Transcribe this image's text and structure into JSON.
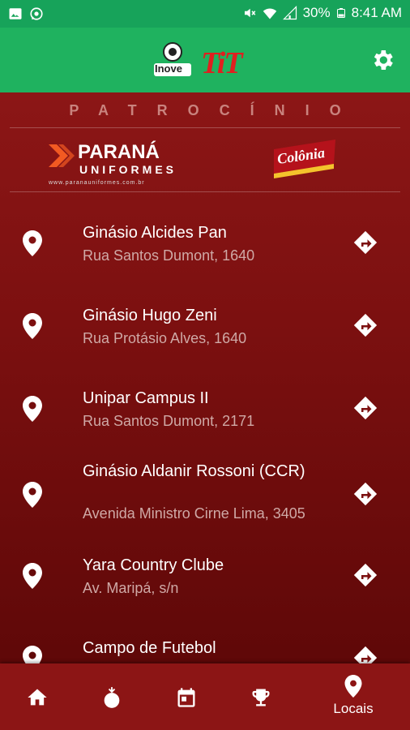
{
  "status_bar": {
    "battery": "30%",
    "time": "8:41 AM",
    "icons": [
      "image-icon",
      "whatsapp-icon",
      "mute-icon",
      "wifi-icon",
      "signal-icon",
      "battery-icon"
    ]
  },
  "app_bar": {
    "logo_inove": "Inove",
    "logo_tit": "TiT",
    "settings_icon": "gear-icon"
  },
  "sponsors": {
    "title": "PATROCÍNIO",
    "parana_name": "PARANÁ",
    "parana_sub": "UNIFORMES",
    "parana_url": "www.paranauniformes.com.br",
    "colonia": "Colônia"
  },
  "locations": [
    {
      "name": "Ginásio Alcides Pan",
      "address": "Rua Santos Dumont, 1640"
    },
    {
      "name": "Ginásio Hugo Zeni",
      "address": "Rua Protásio Alves, 1640"
    },
    {
      "name": "Unipar Campus II",
      "address": "Rua Santos Dumont, 2171"
    },
    {
      "name": "Ginásio Aldanir Rossoni (CCR)",
      "address": "Avenida Ministro Cirne Lima, 3405"
    },
    {
      "name": "Yara Country Clube",
      "address": "Av. Maripá, s/n"
    },
    {
      "name": "Campo de Futebol",
      "address": ""
    }
  ],
  "bottom_nav": {
    "items": [
      {
        "icon": "home-icon"
      },
      {
        "icon": "ball-icon"
      },
      {
        "icon": "calendar-icon"
      },
      {
        "icon": "trophy-icon"
      },
      {
        "icon": "location-icon",
        "label": "Locais"
      }
    ]
  },
  "colors": {
    "primary_green": "#1fb25f",
    "status_green": "#17a35a",
    "maroon": "#8c1515"
  }
}
